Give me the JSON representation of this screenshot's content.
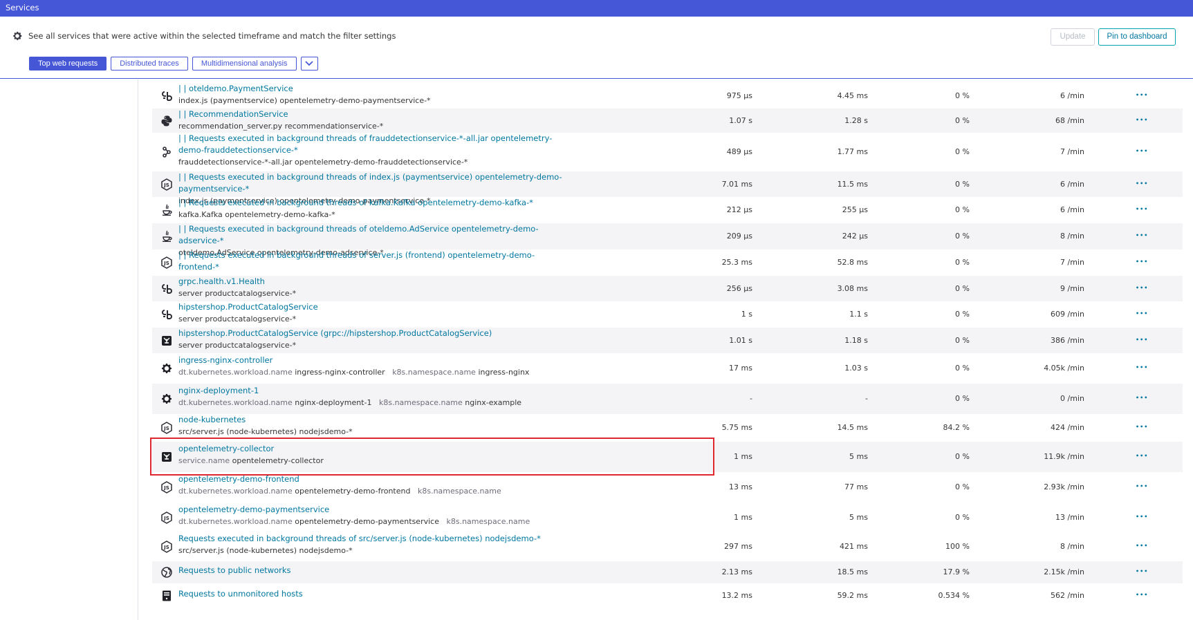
{
  "title": "Services",
  "header": {
    "info_text": "See all services that were active within the selected timeframe and match the filter settings",
    "update_label": "Update",
    "pin_label": "Pin to dashboard",
    "tabs": [
      "Top web requests",
      "Distributed traces",
      "Multidimensional analysis"
    ]
  },
  "rows": [
    {
      "icon": "go-icon",
      "name": "| | oteldemo.PaymentService",
      "sub": "index.js (paymentservice) opentelemetry-demo-paymentservice-*",
      "c1": "975 µs",
      "c2": "4.45 ms",
      "c3": "0 %",
      "c4": "6 /min"
    },
    {
      "icon": "python-icon",
      "name": "| | RecommendationService",
      "sub": "recommendation_server.py recommendationservice-*",
      "c1": "1.07 s",
      "c2": "1.28 s",
      "c3": "0 %",
      "c4": "68 /min"
    },
    {
      "icon": "kotlin-icon",
      "name": "| | Requests executed in background threads of frauddetectionservice-*-all.jar opentelemetry-demo-frauddetectionservice-*",
      "sub": "frauddetectionservice-*-all.jar opentelemetry-demo-frauddetectionservice-*",
      "c1": "489 µs",
      "c2": "1.77 ms",
      "c3": "0 %",
      "c4": "7 /min"
    },
    {
      "icon": "nodejs-icon",
      "name": "| | Requests executed in background threads of index.js (paymentservice) opentelemetry-demo-paymentservice-*",
      "sub": "index.js (paymentservice) opentelemetry-demo-paymentservice-*",
      "c1": "7.01 ms",
      "c2": "11.5 ms",
      "c3": "0 %",
      "c4": "6 /min"
    },
    {
      "icon": "java-icon",
      "name": "| | Requests executed in background threads of kafka.Kafka opentelemetry-demo-kafka-*",
      "sub": "kafka.Kafka opentelemetry-demo-kafka-*",
      "c1": "212 µs",
      "c2": "255 µs",
      "c3": "0 %",
      "c4": "6 /min"
    },
    {
      "icon": "java-icon",
      "name": "| | Requests executed in background threads of oteldemo.AdService opentelemetry-demo-adservice-*",
      "sub": "oteldemo.AdService opentelemetry-demo-adservice-*",
      "c1": "209 µs",
      "c2": "242 µs",
      "c3": "0 %",
      "c4": "8 /min"
    },
    {
      "icon": "nodejs-icon",
      "name": "| | Requests executed in background threads of server.js (frontend) opentelemetry-demo-frontend-*",
      "sub": "server.js (frontend) opentelemetry-demo-frontend-*",
      "c1": "25.3 ms",
      "c2": "52.8 ms",
      "c3": "0 %",
      "c4": "7 /min"
    },
    {
      "icon": "go-icon",
      "name": "grpc.health.v1.Health",
      "sub": "server productcatalogservice-*",
      "c1": "256 µs",
      "c2": "3.08 ms",
      "c3": "0 %",
      "c4": "9 /min"
    },
    {
      "icon": "go-icon",
      "name": "hipstershop.ProductCatalogService",
      "sub": "server productcatalogservice-*",
      "c1": "1 s",
      "c2": "1.1 s",
      "c3": "0 %",
      "c4": "609 /min"
    },
    {
      "icon": "opentelemetry-icon",
      "name": "hipstershop.ProductCatalogService (grpc://hipstershop.ProductCatalogService)",
      "sub": "server productcatalogservice-*",
      "c1": "1.01 s",
      "c2": "1.18 s",
      "c3": "0 %",
      "c4": "386 /min"
    },
    {
      "icon": "gear-icon",
      "name": "ingress-nginx-controller",
      "sub_parts": [
        [
          "dt.kubernetes.workload.name",
          "ingress-nginx-controller"
        ],
        [
          "k8s.namespace.name",
          "ingress-nginx"
        ]
      ],
      "c1": "17 ms",
      "c2": "1.03 s",
      "c3": "0 %",
      "c4": "4.05k /min"
    },
    {
      "icon": "gear-icon",
      "name": "nginx-deployment-1",
      "sub_parts": [
        [
          "dt.kubernetes.workload.name",
          "nginx-deployment-1"
        ],
        [
          "k8s.namespace.name",
          "nginx-example"
        ]
      ],
      "c1": "-",
      "c2": "-",
      "c3": "0 %",
      "c4": "0 /min"
    },
    {
      "icon": "nodejs-icon",
      "name": "node-kubernetes",
      "sub": "src/server.js (node-kubernetes) nodejsdemo-*",
      "c1": "5.75 ms",
      "c2": "14.5 ms",
      "c3": "84.2 %",
      "c4": "424 /min"
    },
    {
      "icon": "opentelemetry-icon",
      "name": "opentelemetry-collector",
      "sub_parts": [
        [
          "service.name",
          "opentelemetry-collector"
        ]
      ],
      "c1": "1 ms",
      "c2": "5 ms",
      "c3": "0 %",
      "c4": "11.9k /min"
    },
    {
      "icon": "nodejs-icon",
      "name": "opentelemetry-demo-frontend",
      "sub_parts": [
        [
          "dt.kubernetes.workload.name",
          "opentelemetry-demo-frontend"
        ],
        [
          "k8s.namespace.name",
          ""
        ]
      ],
      "c1": "13 ms",
      "c2": "77 ms",
      "c3": "0 %",
      "c4": "2.93k /min"
    },
    {
      "icon": "nodejs-icon",
      "name": "opentelemetry-demo-paymentservice",
      "sub_parts": [
        [
          "dt.kubernetes.workload.name",
          "opentelemetry-demo-paymentservice"
        ],
        [
          "k8s.namespace.name",
          ""
        ]
      ],
      "c1": "1 ms",
      "c2": "5 ms",
      "c3": "0 %",
      "c4": "13 /min"
    },
    {
      "icon": "nodejs-icon",
      "name": "Requests executed in background threads of src/server.js (node-kubernetes) nodejsdemo-*",
      "sub": "src/server.js (node-kubernetes) nodejsdemo-*",
      "c1": "297 ms",
      "c2": "421 ms",
      "c3": "100 %",
      "c4": "8 /min"
    },
    {
      "icon": "globe-icon",
      "name": "Requests to public networks",
      "c1": "2.13 ms",
      "c2": "18.5 ms",
      "c3": "17.9 %",
      "c4": "2.15k /min"
    },
    {
      "icon": "server-icon",
      "name": "Requests to unmonitored hosts",
      "c1": "13.2 ms",
      "c2": "59.2 ms",
      "c3": "0.534 %",
      "c4": "562 /min"
    }
  ]
}
